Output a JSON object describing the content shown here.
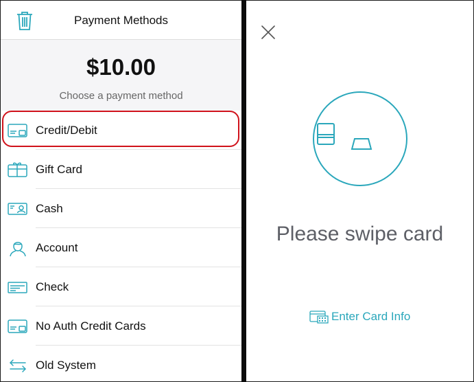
{
  "header": {
    "title": "Payment Methods",
    "trash_icon": "trash-icon"
  },
  "amount": "$10.00",
  "subtitle": "Choose a payment method",
  "methods": [
    {
      "label": "Credit/Debit",
      "icon": "credit-card-icon",
      "selected": true
    },
    {
      "label": "Gift Card",
      "icon": "gift-card-icon"
    },
    {
      "label": "Cash",
      "icon": "cash-icon"
    },
    {
      "label": "Account",
      "icon": "account-icon"
    },
    {
      "label": "Check",
      "icon": "check-icon"
    },
    {
      "label": "No Auth Credit Cards",
      "icon": "no-auth-card-icon"
    },
    {
      "label": "Old System",
      "icon": "transfer-arrows-icon"
    }
  ],
  "swipe": {
    "prompt": "Please swipe card",
    "enter_card_label": "Enter Card Info",
    "close_icon": "close-icon"
  },
  "colors": {
    "accent": "#2aa7bb",
    "highlight": "#d0121b",
    "panel_bg": "#f5f5f7"
  }
}
